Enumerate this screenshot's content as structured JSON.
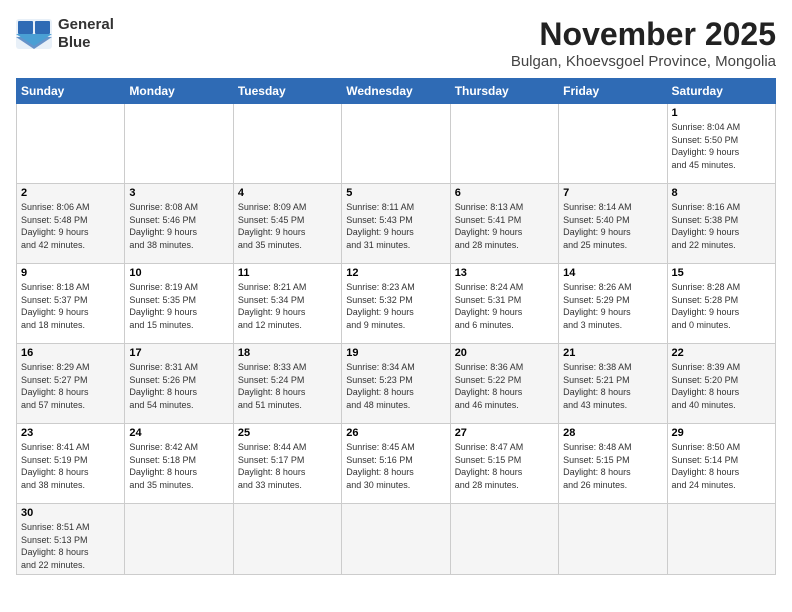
{
  "header": {
    "logo_line1": "General",
    "logo_line2": "Blue",
    "title": "November 2025",
    "subtitle": "Bulgan, Khoevsgoel Province, Mongolia"
  },
  "days_of_week": [
    "Sunday",
    "Monday",
    "Tuesday",
    "Wednesday",
    "Thursday",
    "Friday",
    "Saturday"
  ],
  "weeks": [
    [
      {
        "day": "",
        "info": ""
      },
      {
        "day": "",
        "info": ""
      },
      {
        "day": "",
        "info": ""
      },
      {
        "day": "",
        "info": ""
      },
      {
        "day": "",
        "info": ""
      },
      {
        "day": "",
        "info": ""
      },
      {
        "day": "1",
        "info": "Sunrise: 8:04 AM\nSunset: 5:50 PM\nDaylight: 9 hours\nand 45 minutes."
      }
    ],
    [
      {
        "day": "2",
        "info": "Sunrise: 8:06 AM\nSunset: 5:48 PM\nDaylight: 9 hours\nand 42 minutes."
      },
      {
        "day": "3",
        "info": "Sunrise: 8:08 AM\nSunset: 5:46 PM\nDaylight: 9 hours\nand 38 minutes."
      },
      {
        "day": "4",
        "info": "Sunrise: 8:09 AM\nSunset: 5:45 PM\nDaylight: 9 hours\nand 35 minutes."
      },
      {
        "day": "5",
        "info": "Sunrise: 8:11 AM\nSunset: 5:43 PM\nDaylight: 9 hours\nand 31 minutes."
      },
      {
        "day": "6",
        "info": "Sunrise: 8:13 AM\nSunset: 5:41 PM\nDaylight: 9 hours\nand 28 minutes."
      },
      {
        "day": "7",
        "info": "Sunrise: 8:14 AM\nSunset: 5:40 PM\nDaylight: 9 hours\nand 25 minutes."
      },
      {
        "day": "8",
        "info": "Sunrise: 8:16 AM\nSunset: 5:38 PM\nDaylight: 9 hours\nand 22 minutes."
      }
    ],
    [
      {
        "day": "9",
        "info": "Sunrise: 8:18 AM\nSunset: 5:37 PM\nDaylight: 9 hours\nand 18 minutes."
      },
      {
        "day": "10",
        "info": "Sunrise: 8:19 AM\nSunset: 5:35 PM\nDaylight: 9 hours\nand 15 minutes."
      },
      {
        "day": "11",
        "info": "Sunrise: 8:21 AM\nSunset: 5:34 PM\nDaylight: 9 hours\nand 12 minutes."
      },
      {
        "day": "12",
        "info": "Sunrise: 8:23 AM\nSunset: 5:32 PM\nDaylight: 9 hours\nand 9 minutes."
      },
      {
        "day": "13",
        "info": "Sunrise: 8:24 AM\nSunset: 5:31 PM\nDaylight: 9 hours\nand 6 minutes."
      },
      {
        "day": "14",
        "info": "Sunrise: 8:26 AM\nSunset: 5:29 PM\nDaylight: 9 hours\nand 3 minutes."
      },
      {
        "day": "15",
        "info": "Sunrise: 8:28 AM\nSunset: 5:28 PM\nDaylight: 9 hours\nand 0 minutes."
      }
    ],
    [
      {
        "day": "16",
        "info": "Sunrise: 8:29 AM\nSunset: 5:27 PM\nDaylight: 8 hours\nand 57 minutes."
      },
      {
        "day": "17",
        "info": "Sunrise: 8:31 AM\nSunset: 5:26 PM\nDaylight: 8 hours\nand 54 minutes."
      },
      {
        "day": "18",
        "info": "Sunrise: 8:33 AM\nSunset: 5:24 PM\nDaylight: 8 hours\nand 51 minutes."
      },
      {
        "day": "19",
        "info": "Sunrise: 8:34 AM\nSunset: 5:23 PM\nDaylight: 8 hours\nand 48 minutes."
      },
      {
        "day": "20",
        "info": "Sunrise: 8:36 AM\nSunset: 5:22 PM\nDaylight: 8 hours\nand 46 minutes."
      },
      {
        "day": "21",
        "info": "Sunrise: 8:38 AM\nSunset: 5:21 PM\nDaylight: 8 hours\nand 43 minutes."
      },
      {
        "day": "22",
        "info": "Sunrise: 8:39 AM\nSunset: 5:20 PM\nDaylight: 8 hours\nand 40 minutes."
      }
    ],
    [
      {
        "day": "23",
        "info": "Sunrise: 8:41 AM\nSunset: 5:19 PM\nDaylight: 8 hours\nand 38 minutes."
      },
      {
        "day": "24",
        "info": "Sunrise: 8:42 AM\nSunset: 5:18 PM\nDaylight: 8 hours\nand 35 minutes."
      },
      {
        "day": "25",
        "info": "Sunrise: 8:44 AM\nSunset: 5:17 PM\nDaylight: 8 hours\nand 33 minutes."
      },
      {
        "day": "26",
        "info": "Sunrise: 8:45 AM\nSunset: 5:16 PM\nDaylight: 8 hours\nand 30 minutes."
      },
      {
        "day": "27",
        "info": "Sunrise: 8:47 AM\nSunset: 5:15 PM\nDaylight: 8 hours\nand 28 minutes."
      },
      {
        "day": "28",
        "info": "Sunrise: 8:48 AM\nSunset: 5:15 PM\nDaylight: 8 hours\nand 26 minutes."
      },
      {
        "day": "29",
        "info": "Sunrise: 8:50 AM\nSunset: 5:14 PM\nDaylight: 8 hours\nand 24 minutes."
      }
    ],
    [
      {
        "day": "30",
        "info": "Sunrise: 8:51 AM\nSunset: 5:13 PM\nDaylight: 8 hours\nand 22 minutes."
      },
      {
        "day": "",
        "info": ""
      },
      {
        "day": "",
        "info": ""
      },
      {
        "day": "",
        "info": ""
      },
      {
        "day": "",
        "info": ""
      },
      {
        "day": "",
        "info": ""
      },
      {
        "day": "",
        "info": ""
      }
    ]
  ]
}
